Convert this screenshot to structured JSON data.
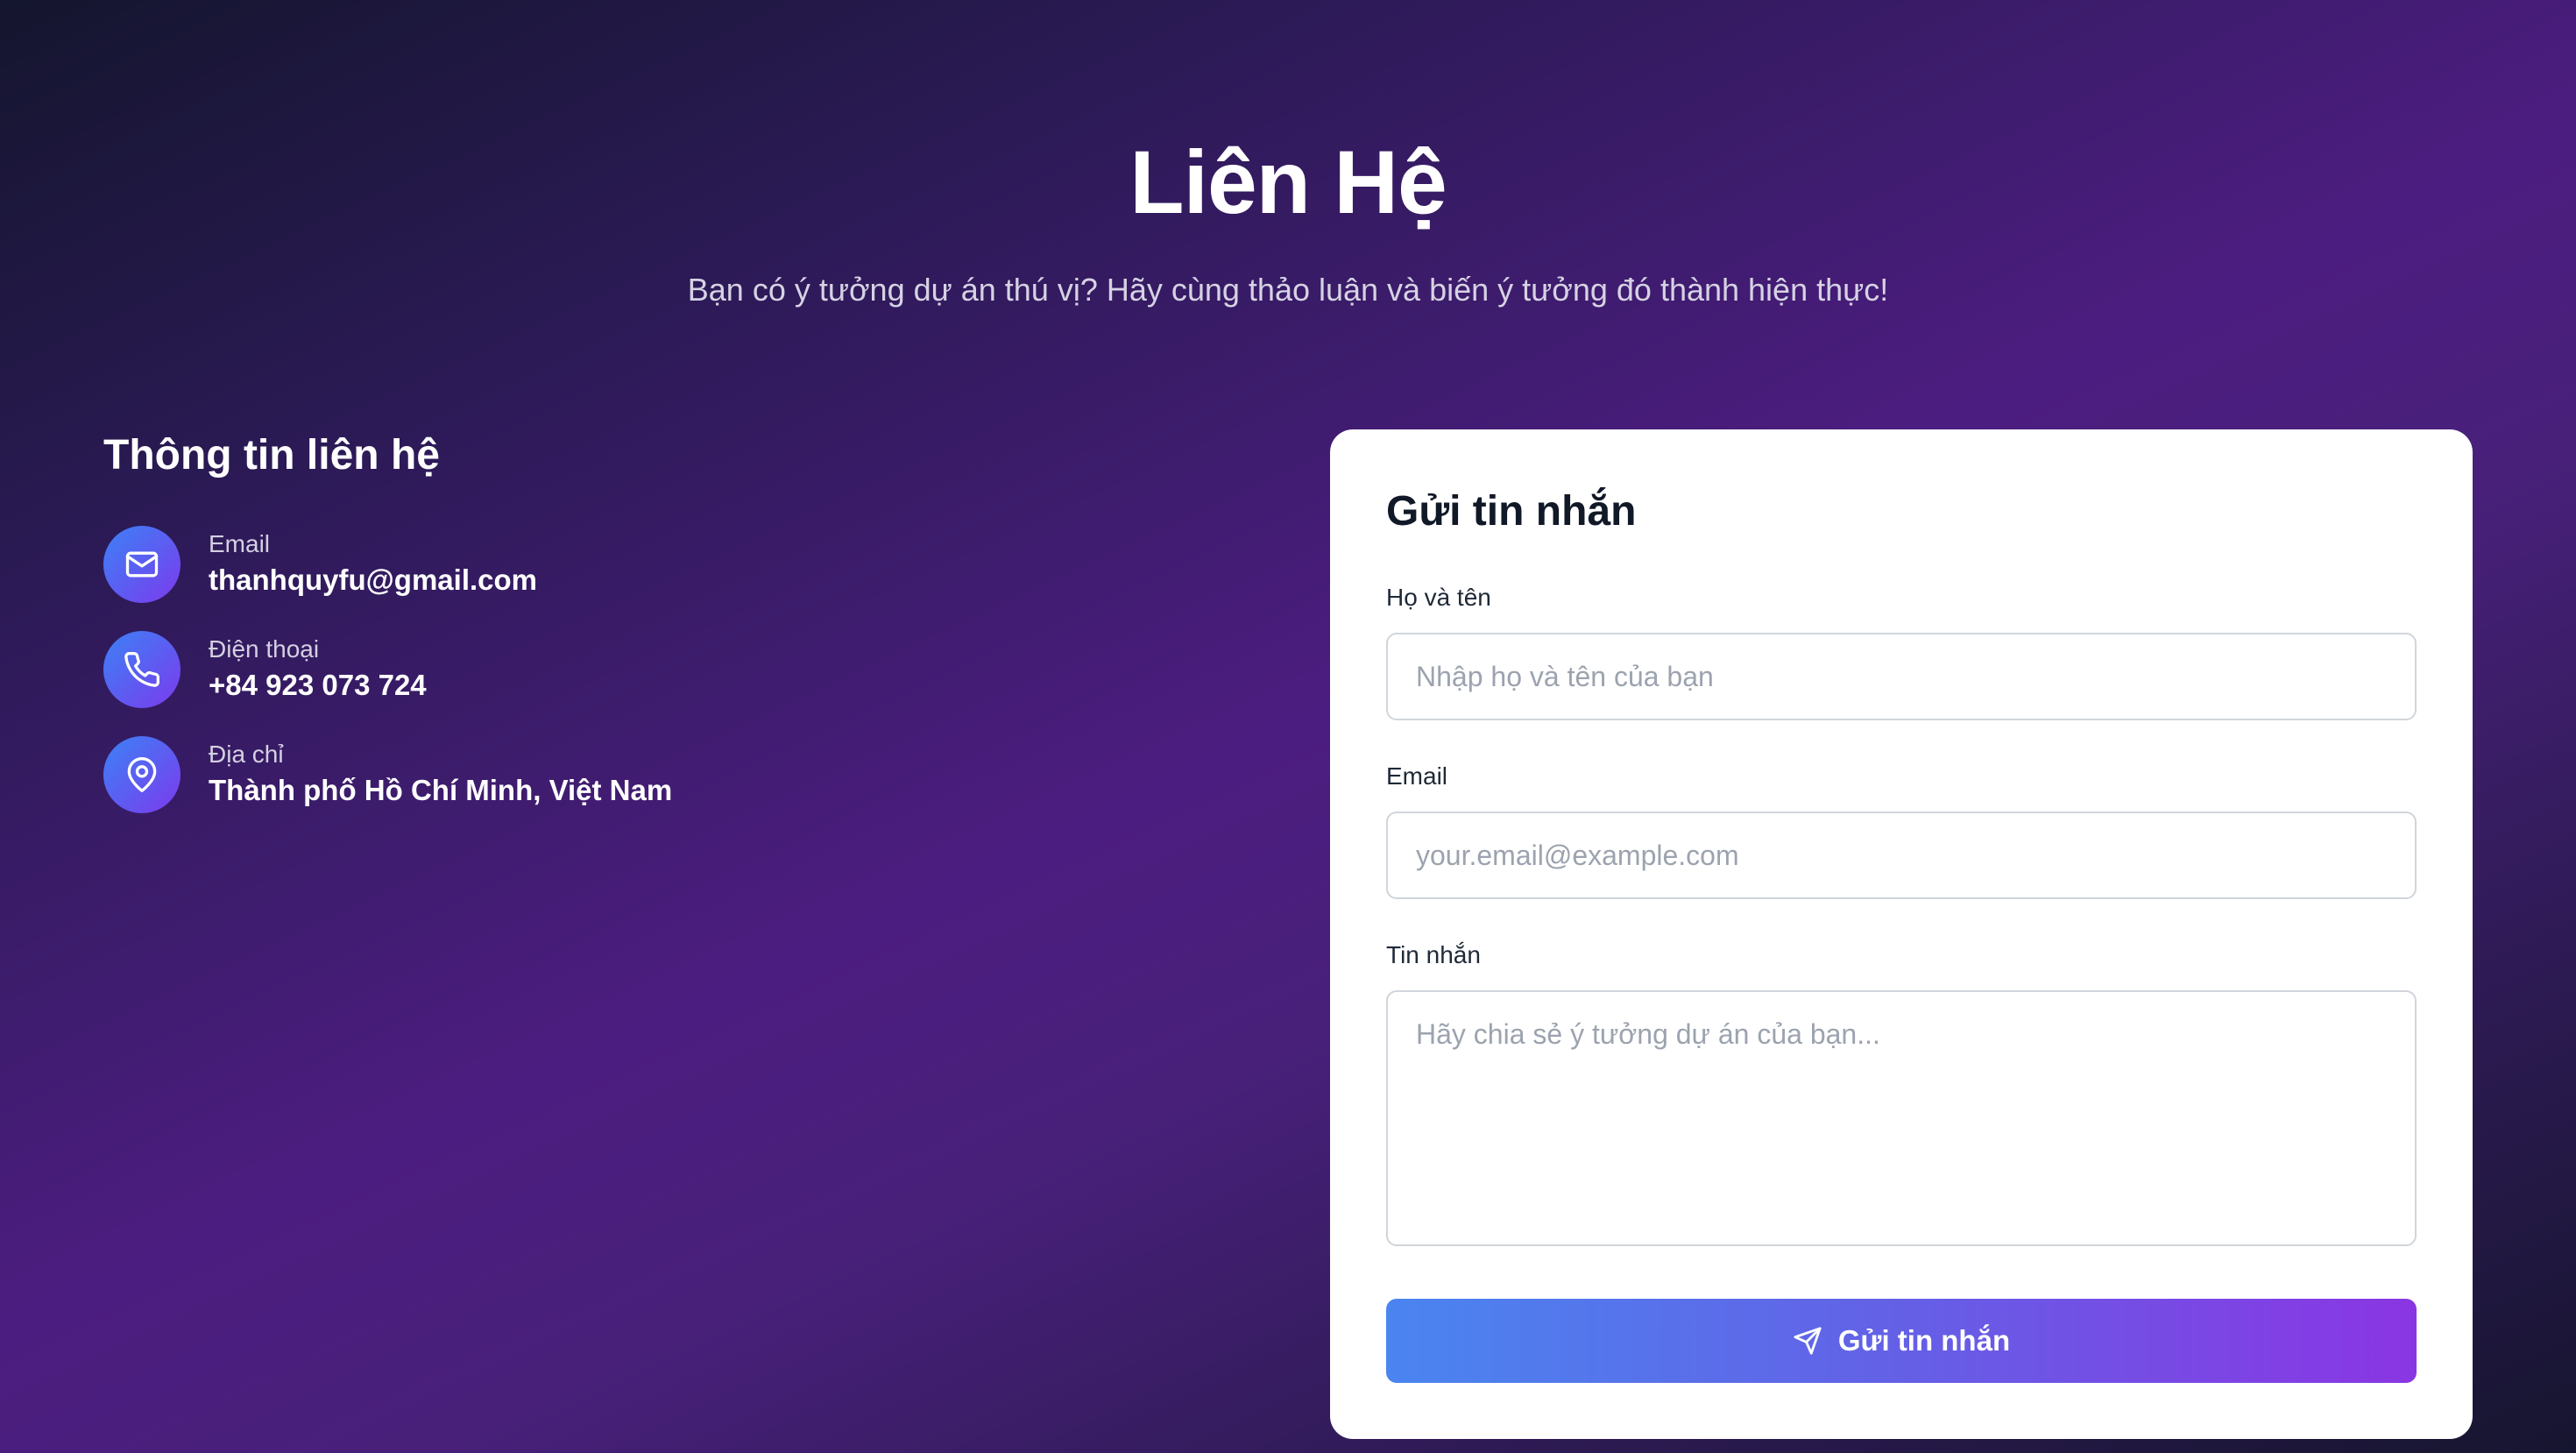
{
  "hero": {
    "title": "Liên Hệ",
    "subtitle": "Bạn có ý tưởng dự án thú vị? Hãy cùng thảo luận và biến ý tưởng đó thành hiện thực!"
  },
  "contact_info": {
    "heading": "Thông tin liên hệ",
    "items": [
      {
        "icon": "mail-icon",
        "label": "Email",
        "value": "thanhquyfu@gmail.com"
      },
      {
        "icon": "phone-icon",
        "label": "Điện thoại",
        "value": "+84 923 073 724"
      },
      {
        "icon": "map-pin-icon",
        "label": "Địa chỉ",
        "value": "Thành phố Hồ Chí Minh, Việt Nam"
      }
    ]
  },
  "form": {
    "title": "Gửi tin nhắn",
    "name": {
      "label": "Họ và tên",
      "placeholder": "Nhập họ và tên của bạn",
      "value": ""
    },
    "email": {
      "label": "Email",
      "placeholder": "your.email@example.com",
      "value": ""
    },
    "message": {
      "label": "Tin nhắn",
      "placeholder": "Hãy chia sẻ ý tưởng dự án của bạn...",
      "value": ""
    },
    "submit_label": "Gửi tin nhắn",
    "submit_icon": "send-icon"
  },
  "colors": {
    "accent_start": "#3b82f6",
    "accent_end": "#8a35e3",
    "background_mid": "#4c1d80"
  }
}
